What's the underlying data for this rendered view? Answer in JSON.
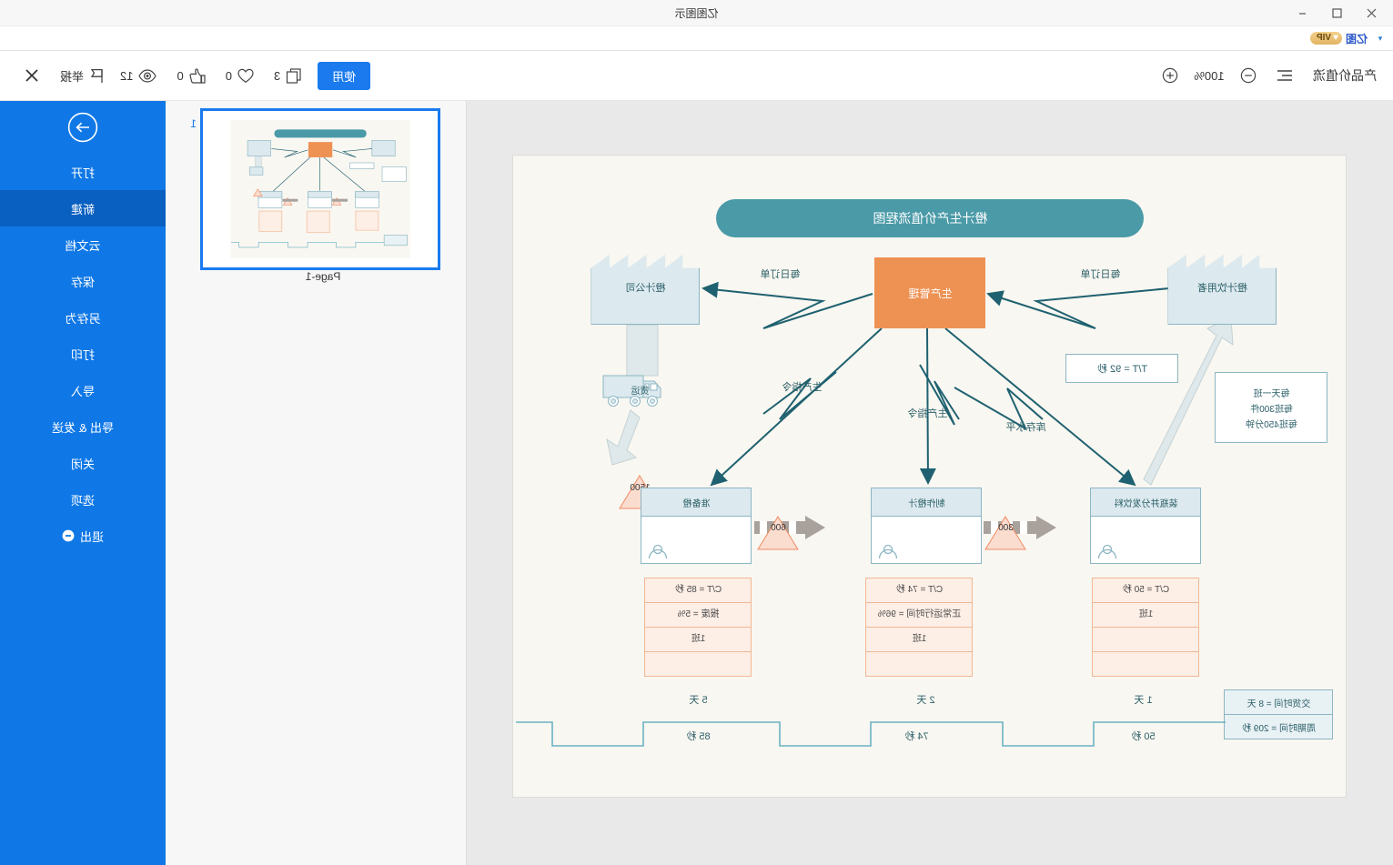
{
  "window": {
    "app_title": "亿图图示",
    "controls": {
      "minimize": "−",
      "maximize": "□",
      "close": "✕"
    }
  },
  "tabstrip": {
    "brand": "亿图",
    "vip_badge": "VIP",
    "caret": "▾"
  },
  "toolbar": {
    "doc_name": "产品价值流",
    "list_icon": "list-icon",
    "zoom": {
      "minus": "−",
      "value": "100%",
      "plus": "+"
    },
    "stats": [
      {
        "icon": "eye-icon",
        "value": "12"
      },
      {
        "icon": "thumbs-up-icon",
        "value": "0"
      },
      {
        "icon": "heart-icon",
        "value": "0"
      },
      {
        "icon": "copy-icon",
        "value": "3"
      }
    ],
    "use_label": "使用",
    "report_label": "举报",
    "close_label": "✕"
  },
  "right_panel": {
    "page_number": "1",
    "page_label": "Page-1"
  },
  "sidebar": {
    "back_icon": "arrow-right-circle-icon",
    "items": [
      {
        "label": "打开",
        "active": false
      },
      {
        "label": "新建",
        "active": true
      },
      {
        "label": "云文档",
        "active": false
      },
      {
        "label": "保存",
        "active": false
      },
      {
        "label": "另存为",
        "active": false
      },
      {
        "label": "打印",
        "active": false
      },
      {
        "label": "导入",
        "active": false
      },
      {
        "label": "导出 & 发送",
        "active": false
      },
      {
        "label": "关闭",
        "active": false
      },
      {
        "label": "选项",
        "active": false
      },
      {
        "label": "退出",
        "active": false,
        "icon": "minus-circle-icon"
      }
    ]
  },
  "diagram": {
    "title": "橙汁生产价值流程图",
    "customer_factory": "橙汁饮用者",
    "supplier_factory": "橙汁公司",
    "production_control": "生产管理",
    "order_label_left": "每日订单",
    "order_label_right": "每日订单",
    "takt_box": "T/T = 92 秒",
    "note_lines": [
      "每天一班",
      "每班300件",
      "每班450分钟"
    ],
    "inventory_label": "库存水平",
    "production_instruction_1": "生产指令",
    "production_instruction_2": "生产指令",
    "shipping_label": "货运",
    "shipping_qty": "1500",
    "processes": [
      {
        "name": "装瓶并分发饮料",
        "data": [
          "C/T = 50 秒",
          "1班",
          "",
          ""
        ]
      },
      {
        "name": "制作橙汁",
        "data": [
          "C/T = 74 秒",
          "正常运行时间 = 96%",
          "1班",
          ""
        ]
      },
      {
        "name": "准备橙",
        "data": [
          "C/T = 85 秒",
          "报废 = 5%",
          "1班",
          ""
        ]
      }
    ],
    "inventories": [
      {
        "qty": "300"
      },
      {
        "qty": "600"
      }
    ],
    "timeline": {
      "lead_time_label": "交货时间 = 8 天",
      "cycle_time_label": "周期时间 = 209 秒",
      "steps": [
        {
          "days": "5 天",
          "seconds": "85 秒"
        },
        {
          "days": "2 天",
          "seconds": "74 秒"
        },
        {
          "days": "1 天",
          "seconds": "50 秒"
        }
      ]
    }
  },
  "colors": {
    "accent_blue": "#1078e6",
    "teal": "#4a9aa8",
    "orange": "#ee9254",
    "pale_blue": "#dce9ee",
    "pale_orange": "#fdeee6",
    "canvas_bg": "#f9f7f1"
  }
}
